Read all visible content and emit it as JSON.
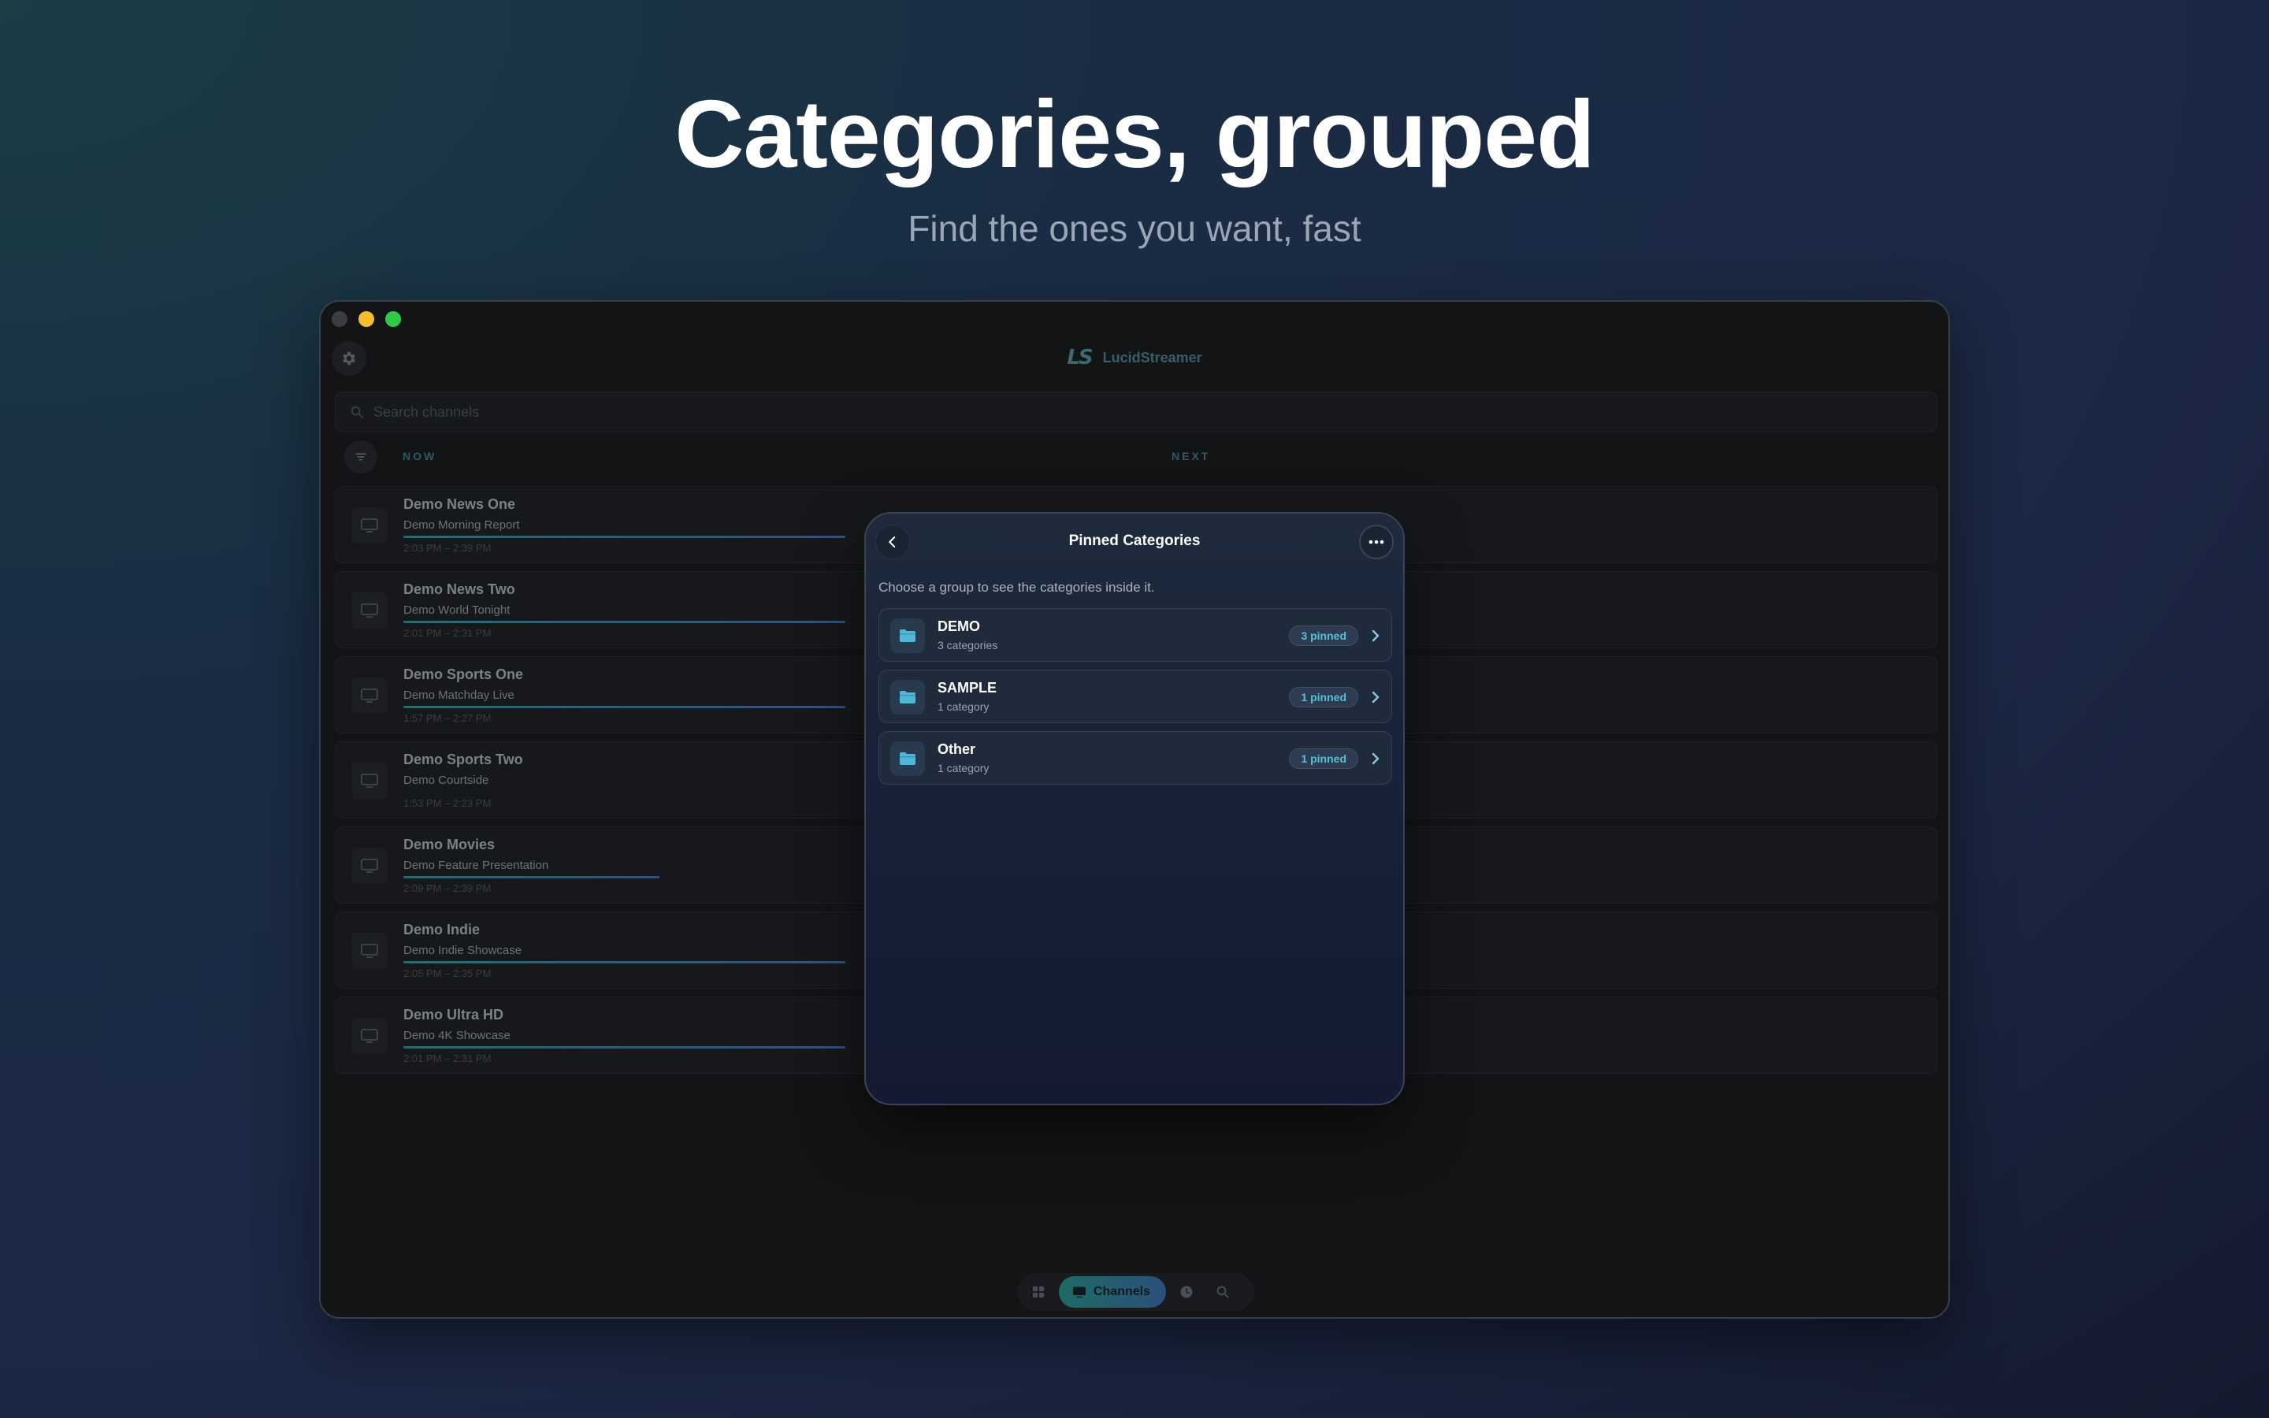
{
  "hero": {
    "title": "Categories, grouped",
    "subtitle": "Find the ones you want, fast"
  },
  "app": {
    "logo": "LS",
    "name": "LucidStreamer"
  },
  "search": {
    "placeholder": "Search channels",
    "value": ""
  },
  "columns": {
    "now": "NOW",
    "next": "NEXT"
  },
  "channels": [
    {
      "name": "Demo News One",
      "program": "Demo Morning Report",
      "time": "2:03 PM – 2:39 PM",
      "progress": 0.95
    },
    {
      "name": "Demo News Two",
      "program": "Demo World Tonight",
      "time": "2:01 PM – 2:31 PM",
      "progress": 0.95
    },
    {
      "name": "Demo Sports One",
      "program": "Demo Matchday Live",
      "time": "1:57 PM – 2:27 PM",
      "progress": 0.95
    },
    {
      "name": "Demo Sports Two",
      "program": "Demo Courtside",
      "time": "1:53 PM – 2:23 PM",
      "progress": 0.0
    },
    {
      "name": "Demo Movies",
      "program": "Demo Feature Presentation",
      "time": "2:09 PM – 2:39 PM",
      "progress": 0.55
    },
    {
      "name": "Demo Indie",
      "program": "Demo Indie Showcase",
      "time": "2:05 PM – 2:35 PM",
      "progress": 0.95
    },
    {
      "name": "Demo Ultra HD",
      "program": "Demo 4K Showcase",
      "time": "2:01 PM – 2:31 PM",
      "progress": 0.95
    }
  ],
  "bottom_nav": {
    "active_label": "Channels",
    "icons": [
      "grid-icon",
      "tv-icon",
      "clock-icon",
      "search-icon"
    ]
  },
  "modal": {
    "title": "Pinned Categories",
    "description": "Choose a group to see the categories inside it.",
    "groups": [
      {
        "name": "DEMO",
        "count": "3 categories",
        "badge": "3 pinned"
      },
      {
        "name": "SAMPLE",
        "count": "1 category",
        "badge": "1 pinned"
      },
      {
        "name": "Other",
        "count": "1 category",
        "badge": "1 pinned"
      }
    ]
  },
  "colors": {
    "accent": "#54c3d6",
    "progress_start": "#2b6a6b",
    "progress_end": "#3a4f7a",
    "close_light": "#3b3d42",
    "minimize_light": "#f6be2e",
    "maximize_light": "#2ec84a"
  }
}
